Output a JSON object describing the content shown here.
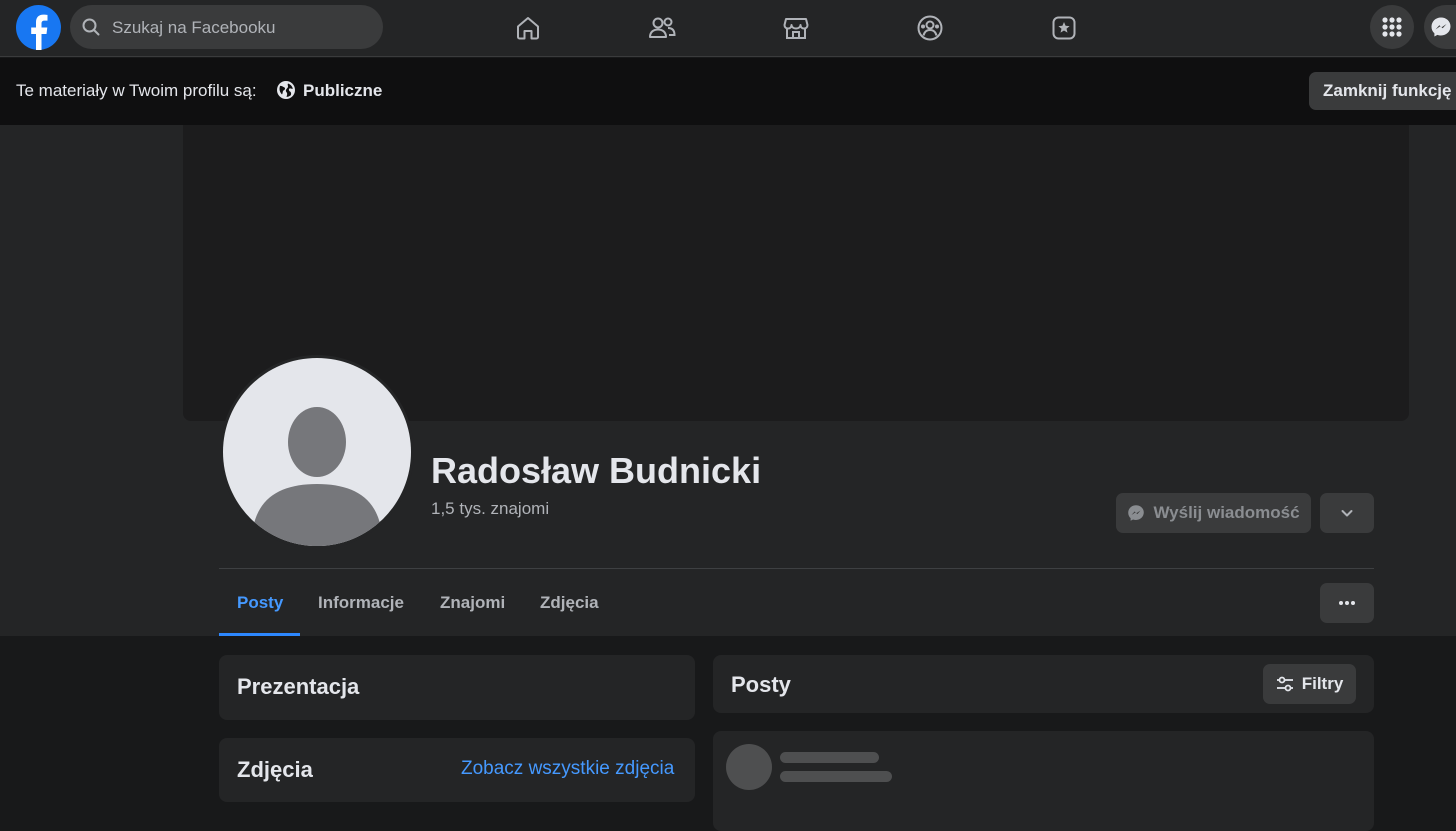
{
  "topbar": {
    "search_placeholder": "Szukaj na Facebooku",
    "nav_icons": [
      "home-icon",
      "friends-icon",
      "marketplace-icon",
      "groups-icon",
      "gaming-icon"
    ],
    "right_buttons": [
      "menu-grid-icon",
      "messenger-icon"
    ]
  },
  "banner": {
    "text": "Te materiały w Twoim profilu są:",
    "visibility": "Publiczne",
    "close_button": "Zamknij funkcję W"
  },
  "profile": {
    "name": "Radosław Budnicki",
    "friends": "1,5 tys. znajomi",
    "message_button": "Wyślij wiadomość"
  },
  "tabs": [
    {
      "label": "Posty",
      "active": true
    },
    {
      "label": "Informacje",
      "active": false
    },
    {
      "label": "Znajomi",
      "active": false
    },
    {
      "label": "Zdjęcia",
      "active": false
    }
  ],
  "left_column": {
    "intro_title": "Prezentacja",
    "photos_title": "Zdjęcia",
    "photos_link": "Zobacz wszystkie zdjęcia"
  },
  "right_column": {
    "posts_title": "Posty",
    "filters_button": "Filtry"
  },
  "colors": {
    "accent": "#2d88ff",
    "link": "#4599ff",
    "background": "#18191a",
    "surface": "#242526"
  }
}
